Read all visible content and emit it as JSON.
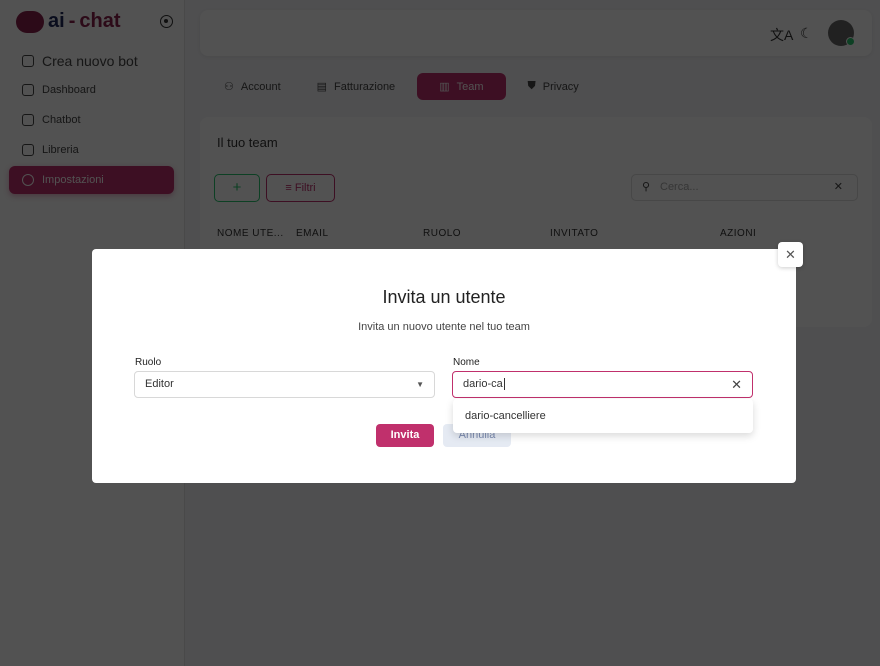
{
  "brand": {
    "prefix": "ai",
    "suffix": "chat"
  },
  "sidebar": {
    "items": [
      {
        "label": "Crea nuovo bot",
        "icon": "plus-square-icon"
      },
      {
        "label": "Dashboard",
        "icon": "home-icon"
      },
      {
        "label": "Chatbot",
        "icon": "robot-icon"
      },
      {
        "label": "Libreria",
        "icon": "library-icon"
      },
      {
        "label": "Impostazioni",
        "icon": "gear-icon",
        "active": true
      }
    ]
  },
  "topbar": {
    "translate_icon": "文A",
    "theme_icon": "☾"
  },
  "tabs": [
    {
      "label": "Account"
    },
    {
      "label": "Fatturazione"
    },
    {
      "label": "Team",
      "active": true
    },
    {
      "label": "Privacy"
    }
  ],
  "team": {
    "title": "Il tuo team",
    "add_label": "+",
    "filter_label": "Filtri",
    "search_placeholder": "Cerca...",
    "columns": [
      "NOME UTE...",
      "EMAIL",
      "RUOLO",
      "INVITATO",
      "AZIONI"
    ]
  },
  "modal": {
    "title": "Invita un utente",
    "subtitle": "Invita un nuovo utente nel tuo team",
    "role_label": "Ruolo",
    "role_value": "Editor",
    "name_label": "Nome",
    "name_value": "dario-ca",
    "suggestions": [
      "dario-cancelliere"
    ],
    "invite_label": "Invita",
    "cancel_label": "Annulla"
  },
  "colors": {
    "accent": "#c0306c",
    "success": "#28c76f"
  }
}
